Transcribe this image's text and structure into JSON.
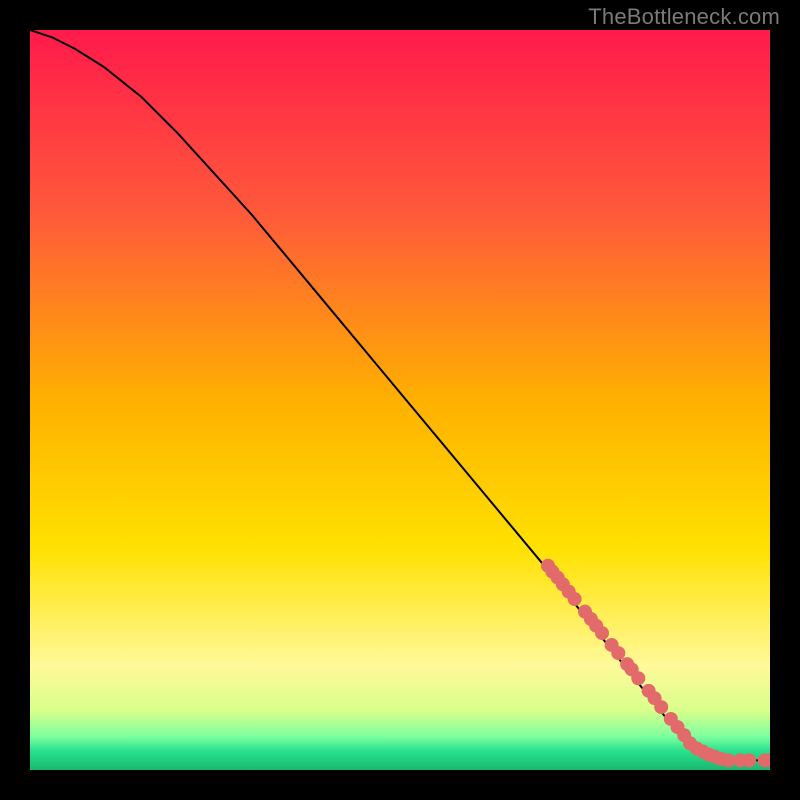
{
  "attribution": "TheBottleneck.com",
  "chart_data": {
    "type": "line",
    "title": "",
    "xlabel": "",
    "ylabel": "",
    "xlim": [
      0,
      100
    ],
    "ylim": [
      0,
      100
    ],
    "grid": false,
    "legend": false,
    "background_gradient": {
      "stops": [
        {
          "pos": 0.0,
          "color": "#ff1a4b"
        },
        {
          "pos": 0.25,
          "color": "#ff5a3a"
        },
        {
          "pos": 0.5,
          "color": "#ffb000"
        },
        {
          "pos": 0.7,
          "color": "#ffe100"
        },
        {
          "pos": 0.86,
          "color": "#fff99a"
        },
        {
          "pos": 0.92,
          "color": "#d8ff8a"
        },
        {
          "pos": 0.955,
          "color": "#7bff9e"
        },
        {
          "pos": 0.975,
          "color": "#26e08b"
        },
        {
          "pos": 1.0,
          "color": "#19b86f"
        }
      ]
    },
    "series": [
      {
        "name": "curve",
        "x": [
          0,
          3,
          6,
          10,
          15,
          20,
          30,
          40,
          50,
          60,
          70,
          78,
          82,
          86,
          90,
          94,
          100
        ],
        "y": [
          100,
          99,
          97.5,
          95,
          91,
          86,
          75,
          63,
          51,
          39,
          27,
          17,
          12,
          7,
          3,
          1.3,
          1.3
        ],
        "stroke": "#000000",
        "stroke_width": 2
      }
    ],
    "highlight_points": {
      "name": "markers",
      "color": "#e36a6a",
      "radius": 7,
      "points": [
        {
          "x": 70,
          "y": 27.6
        },
        {
          "x": 70.6,
          "y": 26.8
        },
        {
          "x": 71.3,
          "y": 26.0
        },
        {
          "x": 72.0,
          "y": 25.1
        },
        {
          "x": 72.8,
          "y": 24.1
        },
        {
          "x": 73.6,
          "y": 23.1
        },
        {
          "x": 75.0,
          "y": 21.4
        },
        {
          "x": 75.8,
          "y": 20.4
        },
        {
          "x": 76.5,
          "y": 19.5
        },
        {
          "x": 77.3,
          "y": 18.5
        },
        {
          "x": 78.6,
          "y": 16.9
        },
        {
          "x": 79.5,
          "y": 15.8
        },
        {
          "x": 80.7,
          "y": 14.3
        },
        {
          "x": 81.3,
          "y": 13.6
        },
        {
          "x": 82.2,
          "y": 12.4
        },
        {
          "x": 83.6,
          "y": 10.7
        },
        {
          "x": 84.4,
          "y": 9.7
        },
        {
          "x": 85.3,
          "y": 8.5
        },
        {
          "x": 86.6,
          "y": 6.9
        },
        {
          "x": 87.5,
          "y": 5.8
        },
        {
          "x": 88.4,
          "y": 4.7
        },
        {
          "x": 89.2,
          "y": 3.6
        },
        {
          "x": 90.1,
          "y": 2.9
        },
        {
          "x": 90.9,
          "y": 2.5
        },
        {
          "x": 91.7,
          "y": 2.1
        },
        {
          "x": 92.5,
          "y": 1.8
        },
        {
          "x": 93.4,
          "y": 1.5
        },
        {
          "x": 94.4,
          "y": 1.3
        },
        {
          "x": 96.0,
          "y": 1.3
        },
        {
          "x": 97.2,
          "y": 1.3
        },
        {
          "x": 99.3,
          "y": 1.3
        },
        {
          "x": 100,
          "y": 1.3
        }
      ]
    }
  }
}
